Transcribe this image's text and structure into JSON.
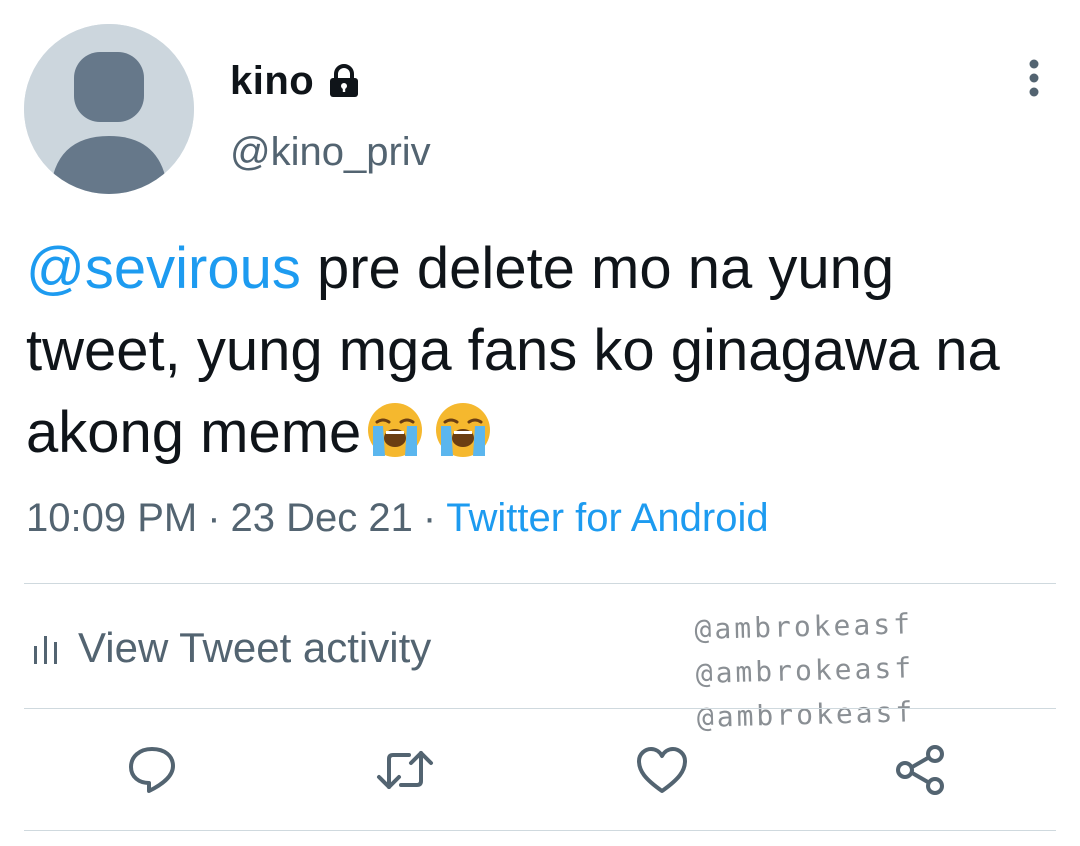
{
  "user": {
    "display_name": "kino",
    "handle": "@kino_priv",
    "protected_icon": "lock-icon"
  },
  "tweet": {
    "mention": "@sevirous",
    "text": " pre delete mo na yung tweet, yung mga fans ko ginagawa na akong meme",
    "emojis": [
      "loudly-crying-face",
      "loudly-crying-face"
    ],
    "time": "10:09 PM",
    "date": "23 Dec 21",
    "separator": "·",
    "source": "Twitter for Android"
  },
  "activity": {
    "icon": "bar-chart-icon",
    "label": "View Tweet activity"
  },
  "watermark": {
    "lines": [
      "@ambrokeasf",
      "@ambrokeasf",
      "@ambrokeasf"
    ]
  },
  "actions": {
    "reply_icon": "reply-icon",
    "retweet_icon": "retweet-icon",
    "like_icon": "heart-icon",
    "share_icon": "share-icon",
    "more_icon": "more-vertical-icon"
  },
  "colors": {
    "accent": "#1d9bf0",
    "text_primary": "#0f1419",
    "text_secondary": "#536471",
    "divider": "#cfd9de",
    "avatar_bg": "#ccd6dd",
    "avatar_fg": "#66788a"
  }
}
